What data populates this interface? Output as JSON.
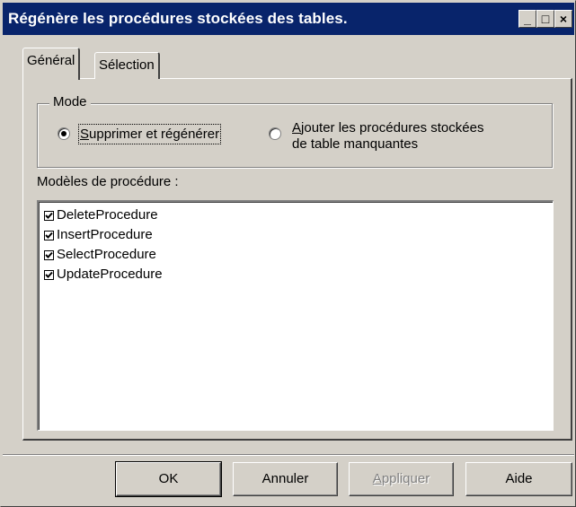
{
  "window": {
    "title": "Régénère les procédures stockées des tables."
  },
  "titlebar_buttons": {
    "minimize": "_",
    "maximize": "□",
    "close": "×"
  },
  "tabs": [
    {
      "label": "Général",
      "active": true
    },
    {
      "label": "Sélection",
      "active": false
    }
  ],
  "mode": {
    "legend": "Mode",
    "options": [
      {
        "label_ul": "S",
        "label_rest": "upprimer et régénérer",
        "selected": true
      },
      {
        "label_ul": "A",
        "label_rest_line1": "jouter les procédures stockées",
        "label_line2": "de table manquantes",
        "selected": false
      }
    ]
  },
  "templates": {
    "label": "Modèles de procédure :",
    "items": [
      {
        "label": "DeleteProcedure",
        "checked": true
      },
      {
        "label": "InsertProcedure",
        "checked": true
      },
      {
        "label": "SelectProcedure",
        "checked": true
      },
      {
        "label": "UpdateProcedure",
        "checked": true
      }
    ]
  },
  "buttons": {
    "ok": "OK",
    "cancel": "Annuler",
    "apply_ul": "A",
    "apply_rest": "ppliquer",
    "help": "Aide"
  }
}
